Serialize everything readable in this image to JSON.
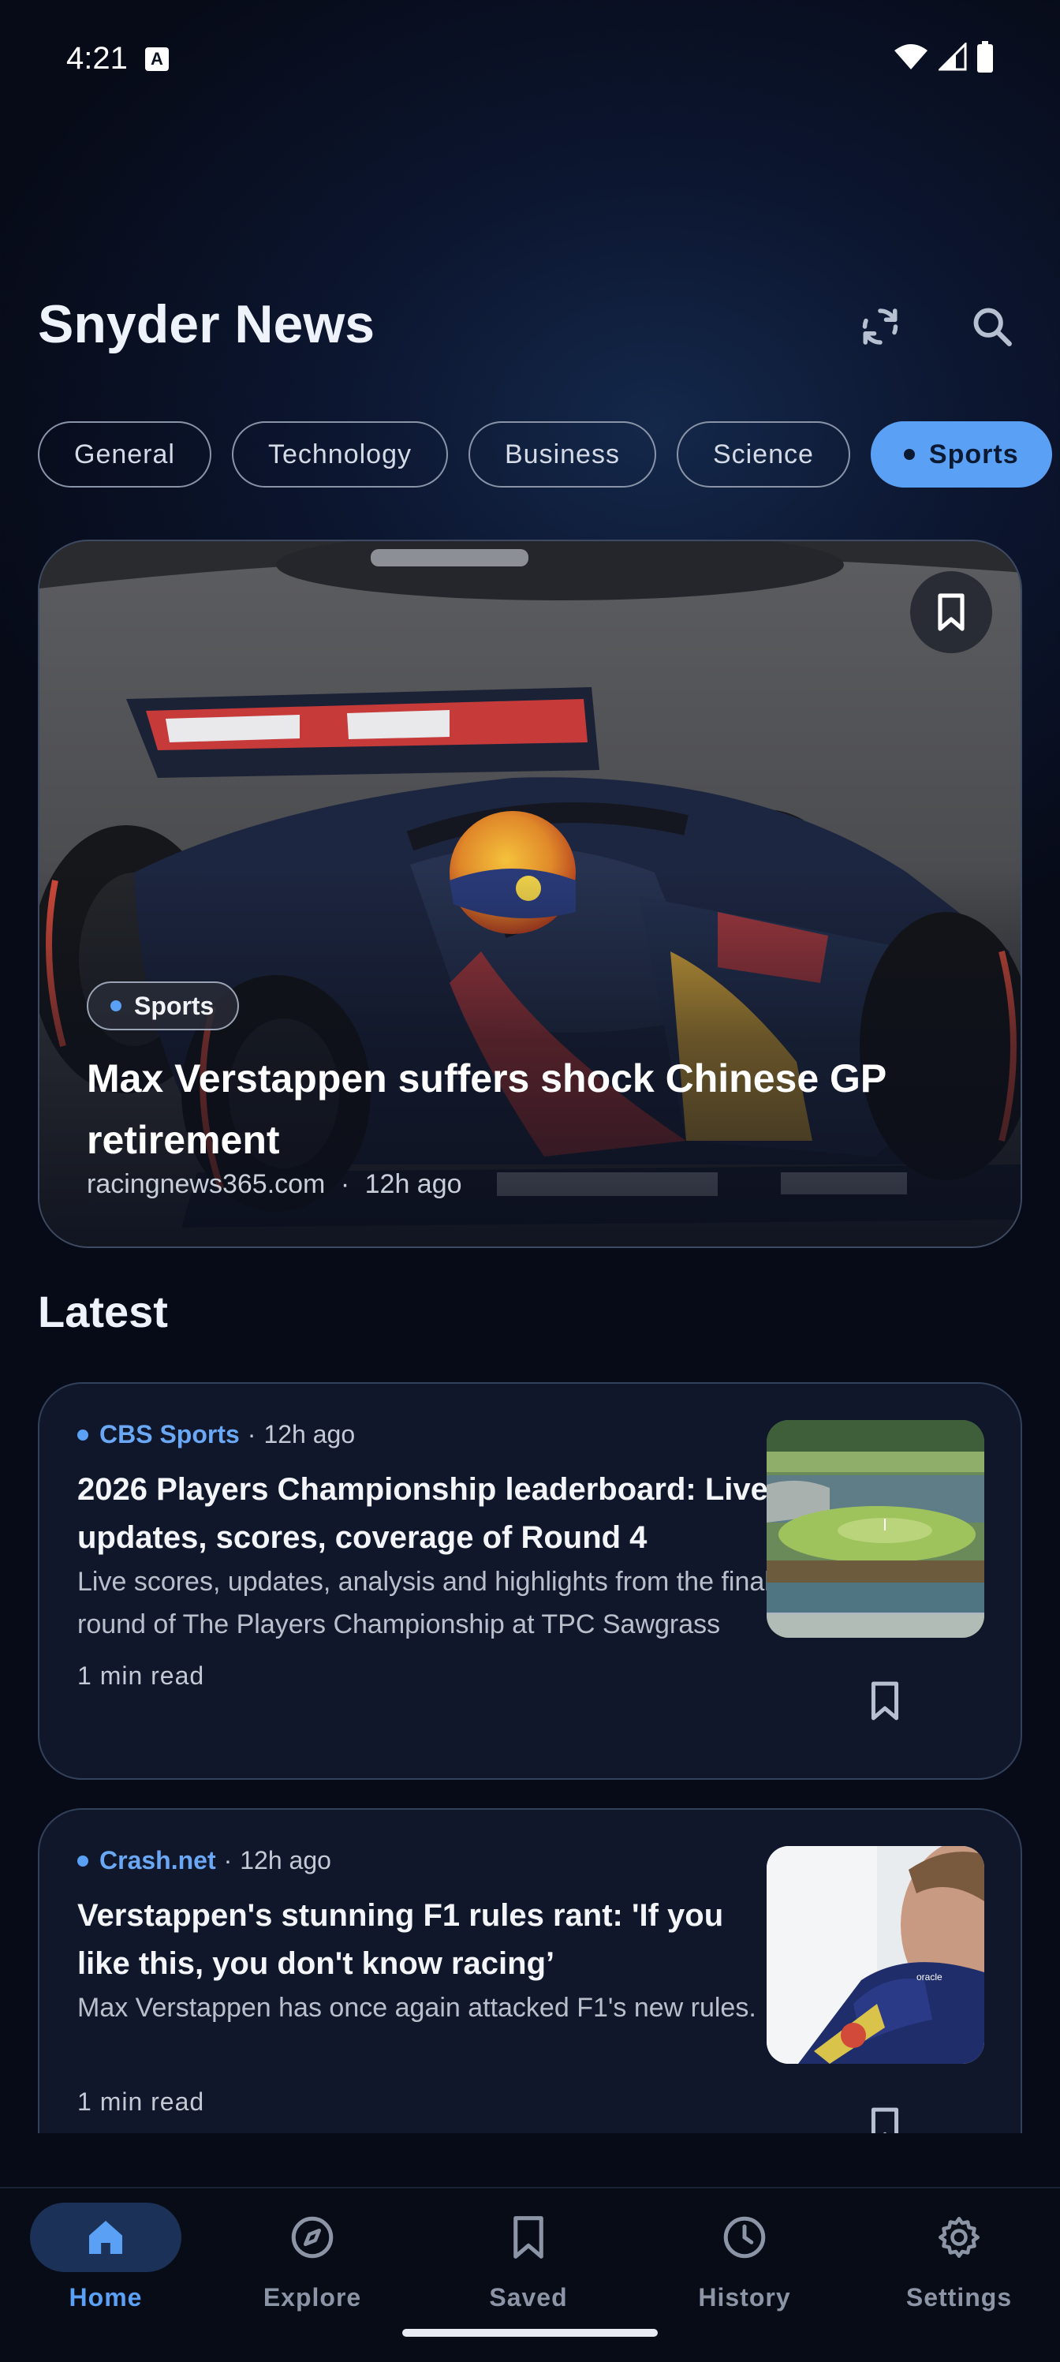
{
  "status_bar": {
    "time": "4:21",
    "notification_glyph": "A"
  },
  "header": {
    "title": "Snyder News",
    "refresh_icon": "refresh-icon",
    "search_icon": "search-icon"
  },
  "categories": [
    {
      "label": "General",
      "selected": false
    },
    {
      "label": "Technology",
      "selected": false
    },
    {
      "label": "Business",
      "selected": false
    },
    {
      "label": "Science",
      "selected": false
    },
    {
      "label": "Sports",
      "selected": true
    }
  ],
  "featured": {
    "category": "Sports",
    "title": "Max Verstappen suffers shock Chinese GP retirement",
    "source": "racingnews365.com",
    "time": "12h ago",
    "separator": "·"
  },
  "latest": {
    "heading": "Latest",
    "articles": [
      {
        "source": "CBS Sports",
        "time": "12h ago",
        "title": "2026 Players Championship leaderboard: Live updates, scores, coverage of Round 4",
        "description": "Live scores, updates, analysis and highlights from the final round of The Players Championship at TPC Sawgrass",
        "read_time": "1 min read"
      },
      {
        "source": "Crash.net",
        "time": "12h ago",
        "title": "Verstappen's stunning F1 rules rant: 'If you like this, you don't know racing’",
        "description": "Max Verstappen has once again attacked F1's new rules.",
        "read_time": "1 min read"
      }
    ]
  },
  "bottom_nav": [
    {
      "label": "Home",
      "icon": "home-icon",
      "active": true
    },
    {
      "label": "Explore",
      "icon": "compass-icon",
      "active": false
    },
    {
      "label": "Saved",
      "icon": "bookmark-icon",
      "active": false
    },
    {
      "label": "History",
      "icon": "clock-icon",
      "active": false
    },
    {
      "label": "Settings",
      "icon": "gear-icon",
      "active": false
    }
  ],
  "colors": {
    "accent": "#5aa0f5",
    "background": "#0a1128",
    "card_border": "#33405a"
  }
}
